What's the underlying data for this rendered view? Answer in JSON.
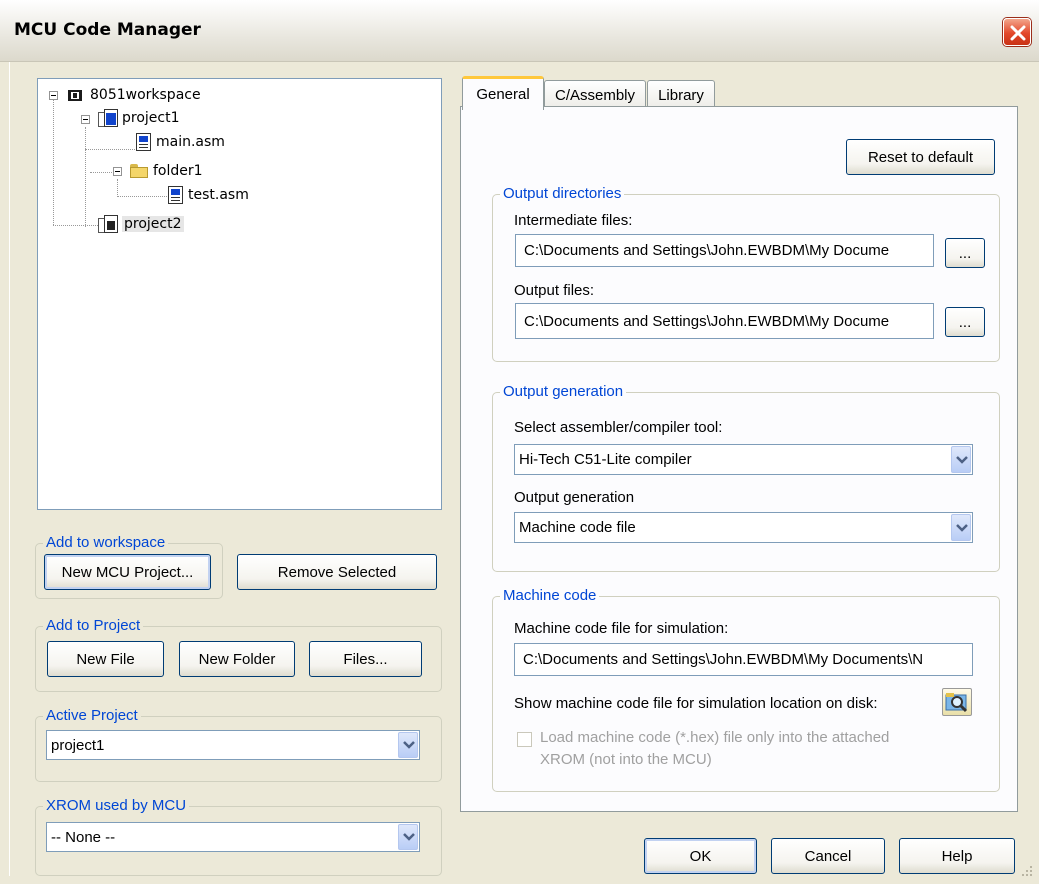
{
  "window": {
    "title": "MCU Code Manager"
  },
  "tree": {
    "workspace": "8051workspace",
    "project1": "project1",
    "main_asm": "main.asm",
    "folder1": "folder1",
    "test_asm": "test.asm",
    "project2": "project2"
  },
  "add_to_workspace": {
    "legend": "Add to workspace",
    "new_mcu_project": "New MCU Project...",
    "remove_selected": "Remove Selected"
  },
  "add_to_project": {
    "legend": "Add to Project",
    "new_file": "New File",
    "new_folder": "New Folder",
    "files": "Files..."
  },
  "active_project": {
    "legend": "Active Project",
    "value": "project1"
  },
  "xrom": {
    "legend": "XROM used by MCU",
    "value": "-- None --"
  },
  "tabs": [
    {
      "label": "General",
      "active": true
    },
    {
      "label": "C/Assembly",
      "active": false
    },
    {
      "label": "Library",
      "active": false
    }
  ],
  "general": {
    "reset_default": "Reset to default",
    "output_directories": {
      "legend": "Output directories",
      "intermediate_label": "Intermediate files:",
      "intermediate_value": "C:\\Documents and Settings\\John.EWBDM\\My Docume",
      "output_label": "Output files:",
      "output_value": "C:\\Documents and Settings\\John.EWBDM\\My Docume",
      "browse": "..."
    },
    "output_generation": {
      "legend": "Output generation",
      "tool_label": "Select assembler/compiler tool:",
      "tool_value": "Hi-Tech C51-Lite compiler",
      "gen_label": "Output generation",
      "gen_value": "Machine code file"
    },
    "machine_code": {
      "legend": "Machine code",
      "file_label": "Machine code file for simulation:",
      "file_value": "C:\\Documents and Settings\\John.EWBDM\\My Documents\\N",
      "show_label": "Show machine code file for simulation location on disk:",
      "load_line1": "Load machine code (*.hex) file only into the attached",
      "load_line2": "XROM (not into the MCU)",
      "load_checked": false
    }
  },
  "footer": {
    "ok": "OK",
    "cancel": "Cancel",
    "help": "Help"
  },
  "colors": {
    "legend": "#0046d5",
    "title_close": "#e3482b",
    "tab_active": "#ffc83c"
  }
}
